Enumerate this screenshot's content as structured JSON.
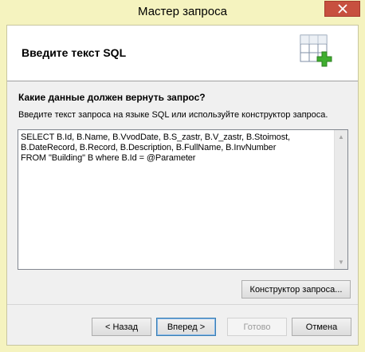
{
  "window": {
    "title": "Мастер запроса"
  },
  "header": {
    "title": "Введите текст SQL",
    "icon": "table-add-icon"
  },
  "body": {
    "question": "Какие данные должен вернуть запрос?",
    "hint": "Введите текст запроса на языке SQL или используйте конструктор запроса.",
    "sql": "SELECT B.Id, B.Name, B.VvodDate, B.S_zastr, B.V_zastr, B.Stoimost,\nB.DateRecord, B.Record, B.Description, B.FullName, B.InvNumber\nFROM \"Building\" B where B.Id = @Parameter"
  },
  "buttons": {
    "constructor": "Конструктор запроса...",
    "back": "< Назад",
    "next": "Вперед >",
    "finish": "Готово",
    "cancel": "Отмена"
  },
  "colors": {
    "frame": "#f5f3bf",
    "close": "#c7503f",
    "accent": "#3c7fb1"
  }
}
